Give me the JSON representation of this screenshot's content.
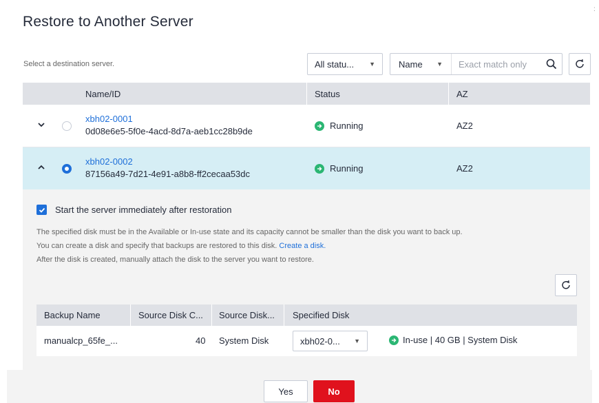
{
  "dialog": {
    "title": "Restore to Another Server",
    "hint": "Select a destination server."
  },
  "filters": {
    "status_value": "All statu...",
    "search_field": "Name",
    "search_placeholder": "Exact match only"
  },
  "server_table": {
    "columns": [
      "Name/ID",
      "Status",
      "AZ"
    ],
    "rows": [
      {
        "name": "xbh02-0001",
        "id": "0d08e6e5-5f0e-4acd-8d7a-aeb1cc28b9de",
        "status": "Running",
        "az": "AZ2",
        "selected": false,
        "expanded": false
      },
      {
        "name": "xbh02-0002",
        "id": "87156a49-7d21-4e91-a8b8-ff2cecaa53dc",
        "status": "Running",
        "az": "AZ2",
        "selected": true,
        "expanded": true
      }
    ]
  },
  "expanded_panel": {
    "start_label": "Start the server immediately after restoration",
    "start_checked": true,
    "note_line1": "The specified disk must be in the Available or In-use state and its capacity cannot be smaller than the disk you want to back up.",
    "note_line2": "You can create a disk and specify that backups are restored to this disk.",
    "create_link": "Create a disk.",
    "note_line3": "After the disk is created, manually attach the disk to the server you want to restore.",
    "disk_table": {
      "columns": [
        "Backup Name",
        "Source Disk C...",
        "Source Disk...",
        "Specified Disk"
      ],
      "rows": [
        {
          "backup_name": "manualcp_65fe_...",
          "capacity": "40",
          "source_disk": "System Disk",
          "specified_disk": "xbh02-0...",
          "disk_status": "In-use | 40 GB | System Disk"
        }
      ]
    }
  },
  "footer": {
    "yes_label": "Yes",
    "no_label": "No"
  },
  "colors": {
    "accent": "#1e6fd9",
    "running": "#2bb673",
    "danger": "#e0121d",
    "selected_row": "#d6eef5"
  }
}
